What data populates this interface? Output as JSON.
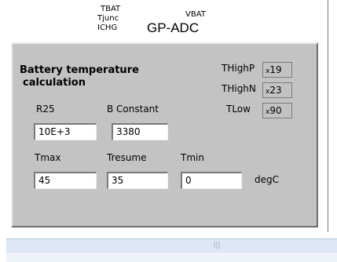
{
  "top_labels": {
    "tbat": "TBAT",
    "tjunc": "Tjunc",
    "ichg": "ICHG",
    "vbat": "VBAT",
    "section": "GP-ADC"
  },
  "panel": {
    "title_line1": "Battery temperature",
    "title_line2": "calculation",
    "r25": {
      "label": "R25",
      "value": "10E+3"
    },
    "bconst": {
      "label": "B Constant",
      "value": "3380"
    },
    "tmax": {
      "label": "Tmax",
      "value": "45"
    },
    "tresume": {
      "label": "Tresume",
      "value": "35"
    },
    "tmin": {
      "label": "Tmin",
      "value": "0"
    },
    "unit": "degC",
    "thighp": {
      "label": "THighP",
      "value": "19"
    },
    "thighn": {
      "label": "THighN",
      "value": "23"
    },
    "tlow": {
      "label": "TLow",
      "value": "90"
    },
    "hex_prefix": "x"
  },
  "scrollbar": {
    "thumb_grip": "|||"
  }
}
